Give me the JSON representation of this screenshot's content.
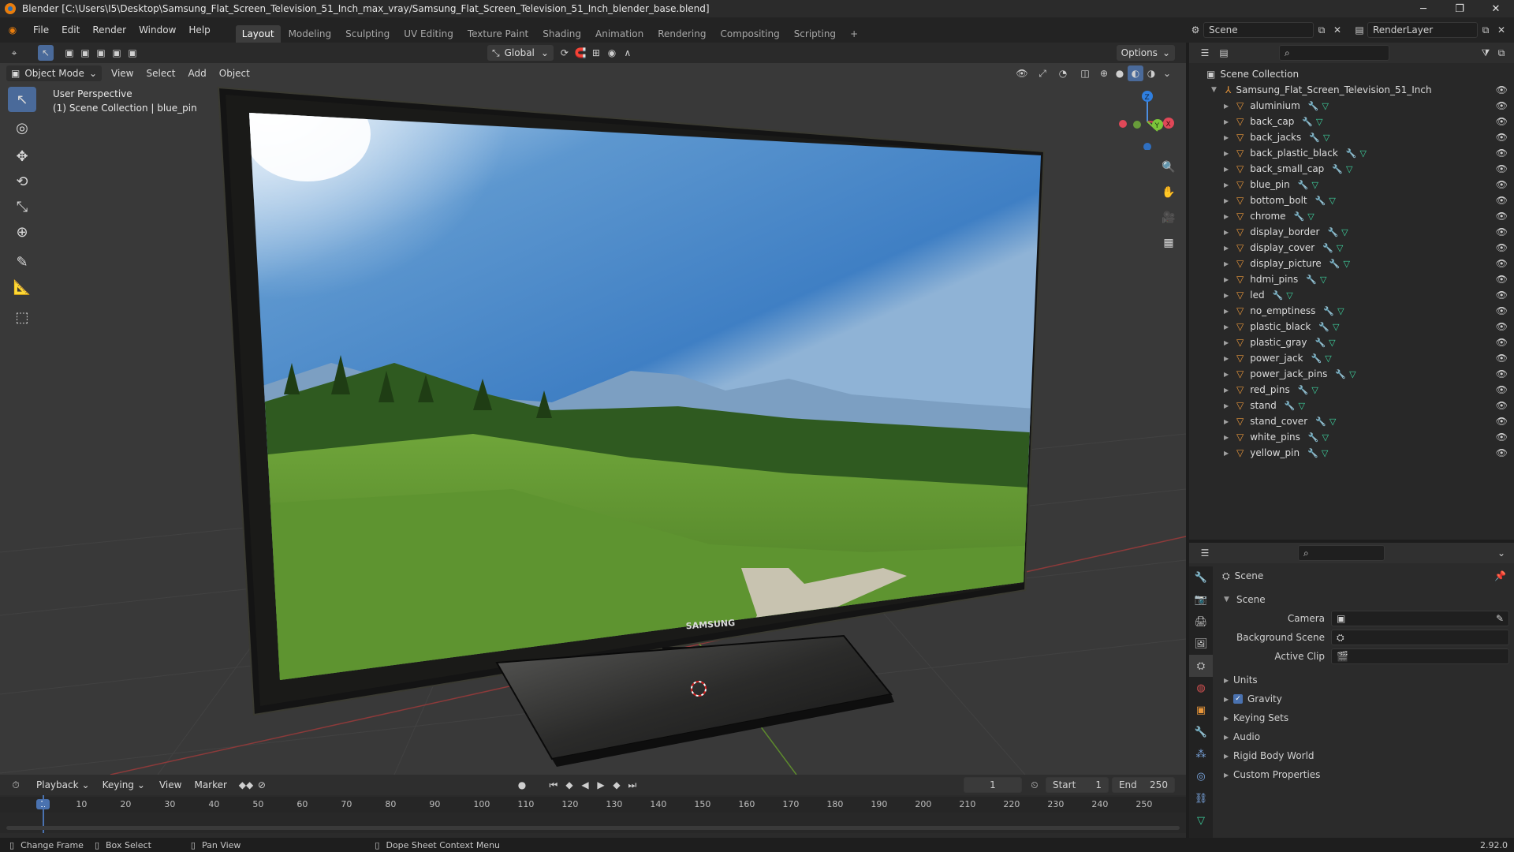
{
  "window": {
    "title": "Blender [C:\\Users\\I5\\Desktop\\Samsung_Flat_Screen_Television_51_Inch_max_vray/Samsung_Flat_Screen_Television_51_Inch_blender_base.blend]",
    "minimize": "─",
    "maximize": "❐",
    "close": "✕"
  },
  "menu": [
    "File",
    "Edit",
    "Render",
    "Window",
    "Help"
  ],
  "workspaces": [
    "Layout",
    "Modeling",
    "Sculpting",
    "UV Editing",
    "Texture Paint",
    "Shading",
    "Animation",
    "Rendering",
    "Compositing",
    "Scripting"
  ],
  "scene_selector": {
    "scene": "Scene",
    "render_layer": "RenderLayer"
  },
  "viewport_header": {
    "mode": "Object Mode",
    "menus": [
      "View",
      "Select",
      "Add",
      "Object"
    ],
    "transform": "Global",
    "options": "Options"
  },
  "viewport": {
    "perspective": "User Perspective",
    "collection": "(1) Scene Collection | blue_pin",
    "brand": "SAMSUNG",
    "gizmo": {
      "x": "X",
      "y": "Y",
      "z": "Z"
    }
  },
  "outliner": {
    "root": "Scene Collection",
    "collection": "Samsung_Flat_Screen_Television_51_Inch",
    "objects": [
      "aluminium",
      "back_cap",
      "back_jacks",
      "back_plastic_black",
      "back_small_cap",
      "blue_pin",
      "bottom_bolt",
      "chrome",
      "display_border",
      "display_cover",
      "display_picture",
      "hdmi_pins",
      "led",
      "no_emptiness",
      "plastic_black",
      "plastic_gray",
      "power_jack",
      "power_jack_pins",
      "red_pins",
      "stand",
      "stand_cover",
      "white_pins",
      "yellow_pin"
    ]
  },
  "properties": {
    "context": "Scene",
    "panel": "Scene",
    "camera_label": "Camera",
    "background_label": "Background Scene",
    "clip_label": "Active Clip",
    "sections": [
      "Units",
      "Gravity",
      "Keying Sets",
      "Audio",
      "Rigid Body World",
      "Custom Properties"
    ]
  },
  "timeline": {
    "menus": [
      "Playback",
      "Keying",
      "View",
      "Marker"
    ],
    "current_frame": "1",
    "start_label": "Start",
    "start": "1",
    "end_label": "End",
    "end": "250",
    "ticks": [
      "1",
      "10",
      "20",
      "30",
      "40",
      "50",
      "60",
      "70",
      "80",
      "90",
      "100",
      "110",
      "120",
      "130",
      "140",
      "150",
      "160",
      "170",
      "180",
      "190",
      "200",
      "210",
      "220",
      "230",
      "240",
      "250"
    ]
  },
  "statusbar": {
    "items": [
      "Change Frame",
      "Box Select",
      "Pan View",
      "Dope Sheet Context Menu"
    ],
    "version": "2.92.0"
  },
  "colors": {
    "accent": "#4a6a9a",
    "object_icon": "#e8963a",
    "mesh_icon": "#3ed4a0"
  }
}
